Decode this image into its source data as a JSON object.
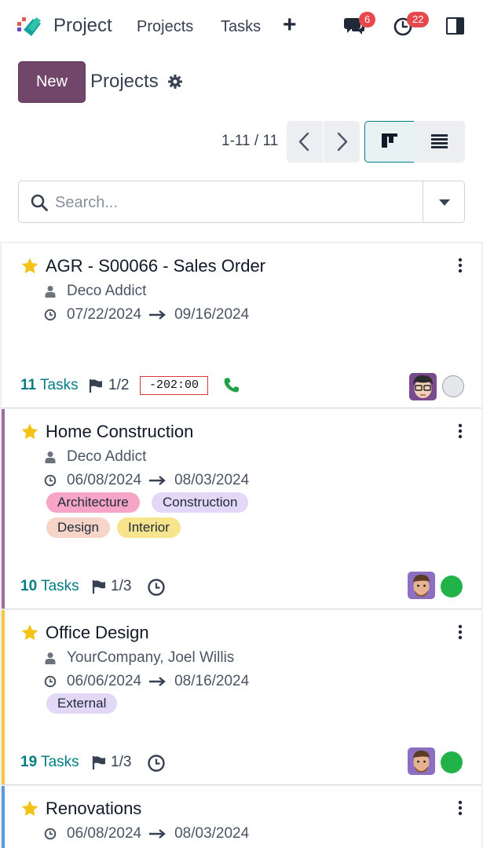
{
  "nav": {
    "app_title": "Project",
    "menu": [
      "Projects",
      "Tasks"
    ],
    "plus": "+",
    "messages_count": "6",
    "activities_count": "22"
  },
  "control": {
    "new_label": "New",
    "breadcrumb": "Projects",
    "pager": "1-11 / 11"
  },
  "search": {
    "placeholder": "Search..."
  },
  "colors": {
    "accent": "#71466a",
    "teal": "#017e84",
    "green_status": "#21b34a",
    "star": "#f3c417"
  },
  "projects": [
    {
      "title": "AGR - S00066 - Sales Order",
      "customer": "Deco Addict",
      "date_start": "07/22/2024",
      "date_end": "09/16/2024",
      "tags": [],
      "tasks_count": "11",
      "tasks_label": "Tasks",
      "milestones": "1/2",
      "deadline": "-202:00",
      "activity": "phone-icon",
      "status": "none"
    },
    {
      "title": "Home Construction",
      "customer": "Deco Addict",
      "date_start": "06/08/2024",
      "date_end": "08/03/2024",
      "tags": [
        "Architecture",
        "Construction",
        "Design",
        "Interior"
      ],
      "tasks_count": "10",
      "tasks_label": "Tasks",
      "milestones": "1/3",
      "activity": "clock-icon",
      "status": "on-track"
    },
    {
      "title": "Office Design",
      "customer": "YourCompany, Joel Willis",
      "date_start": "06/06/2024",
      "date_end": "08/16/2024",
      "tags": [
        "External"
      ],
      "tasks_count": "19",
      "tasks_label": "Tasks",
      "milestones": "1/3",
      "activity": "clock-icon",
      "status": "on-track"
    },
    {
      "title": "Renovations",
      "date_start": "06/08/2024",
      "date_end": "08/03/2024"
    }
  ]
}
